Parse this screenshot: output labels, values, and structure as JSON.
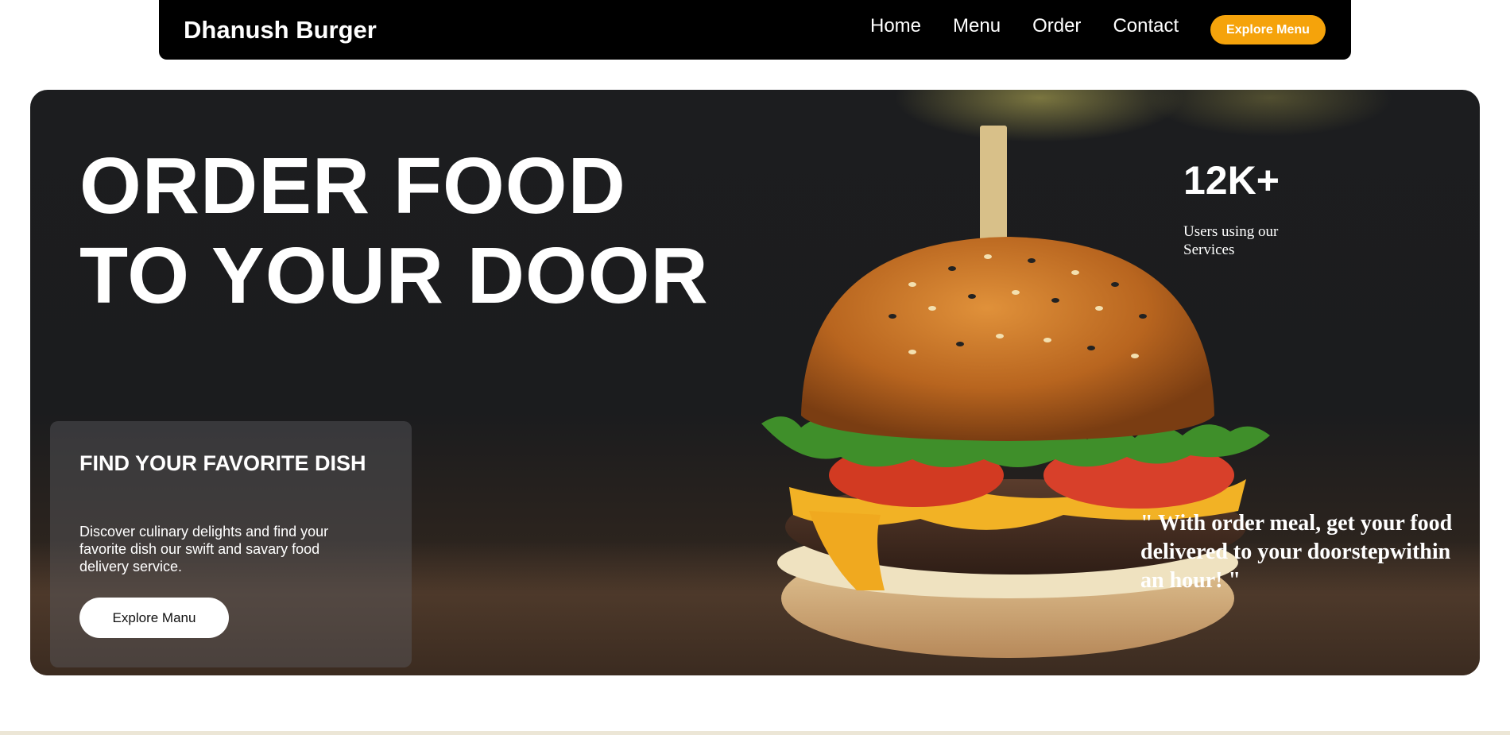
{
  "navbar": {
    "brand": "Dhanush Burger",
    "links": [
      "Home",
      "Menu",
      "Order",
      "Contact"
    ],
    "cta_label": "Explore Menu"
  },
  "hero": {
    "title_line1": "ORDER FOOD",
    "title_line2": "TO YOUR DOOR",
    "stat_number": "12K+",
    "stat_label": "Users using our Services",
    "quote": "\" With order meal, get your food delivered to your doorstepwithin an hour! \"",
    "card": {
      "title": "FIND YOUR FAVORITE DISH",
      "text": "Discover culinary delights and find your favorite dish our swift and savary food delivery service.",
      "button_label": "Explore Manu"
    }
  },
  "colors": {
    "navbar_bg": "#000000",
    "accent": "#f5a30b",
    "text": "#ffffff"
  }
}
